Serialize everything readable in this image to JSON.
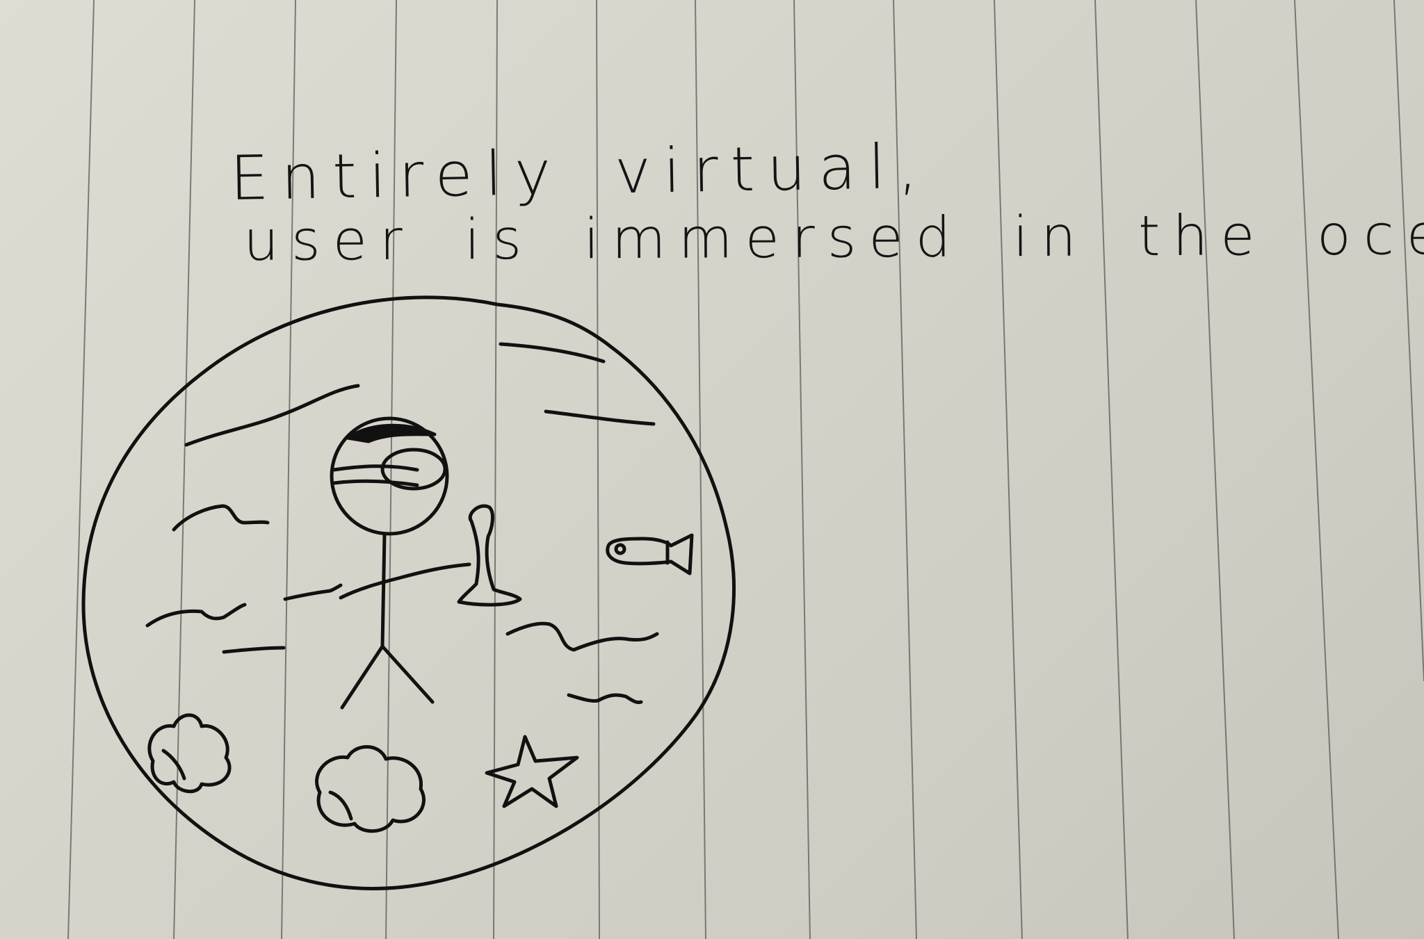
{
  "caption": {
    "line1": "Entirely virtual,",
    "line2": "user is immersed in the ocean"
  },
  "colors": {
    "paper": "#d8d6cc",
    "ink": "#111111",
    "rule_line": "#5a5a58"
  }
}
